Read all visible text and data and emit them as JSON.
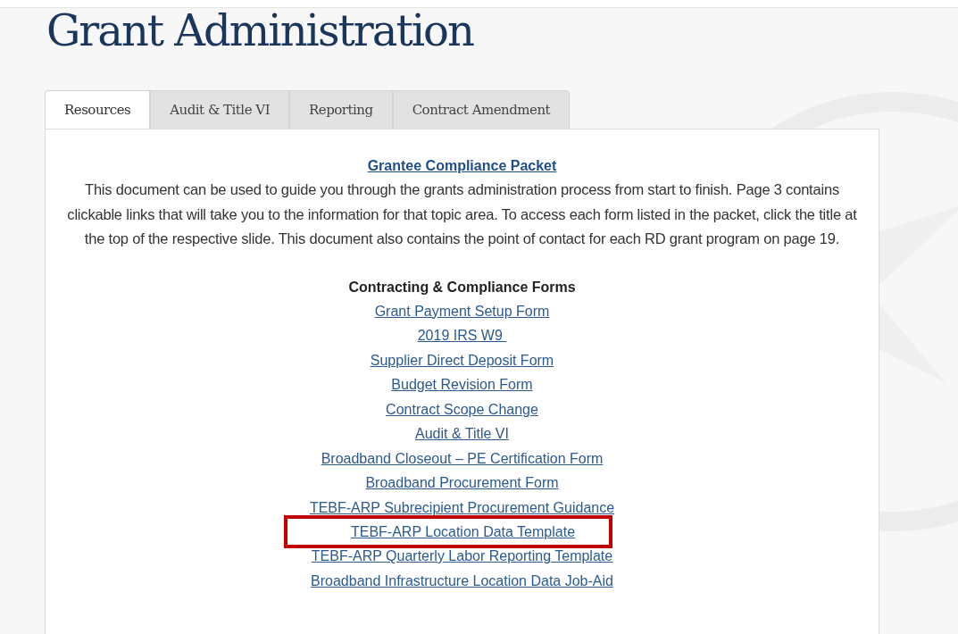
{
  "page_title": "Grant Administration",
  "tabs": [
    {
      "label": "Resources",
      "selected": true
    },
    {
      "label": "Audit & Title VI",
      "selected": false
    },
    {
      "label": "Reporting",
      "selected": false
    },
    {
      "label": "Contract Amendment",
      "selected": false
    }
  ],
  "packet": {
    "link": "Grantee Compliance Packet",
    "description": "This document can be used to guide you through the grants administration process from start to finish. Page 3 contains clickable links that will take you to the information for that topic area. To access each form listed in the packet, click the title at the top of the respective slide. This document also contains the point of contact for each RD grant program on page 19."
  },
  "forms": {
    "heading": "Contracting & Compliance Forms",
    "links": [
      {
        "label": "Grant Payment Setup Form",
        "highlighted": false
      },
      {
        "label": "2019 IRS W9 ",
        "highlighted": false
      },
      {
        "label": "Supplier Direct Deposit Form",
        "highlighted": false
      },
      {
        "label": "Budget Revision Form",
        "highlighted": false
      },
      {
        "label": "Contract Scope Change",
        "highlighted": false
      },
      {
        "label": "Audit & Title VI",
        "highlighted": false
      },
      {
        "label": "Broadband Closeout – PE Certification Form",
        "highlighted": false
      },
      {
        "label": "Broadband Procurement Form",
        "highlighted": false
      },
      {
        "label": "TEBF-ARP Subrecipient Procurement Guidance",
        "highlighted": false
      },
      {
        "label": "TEBF-ARP Location Data Template",
        "highlighted": true
      },
      {
        "label": "TEBF-ARP Quarterly Labor Reporting Template",
        "highlighted": false
      },
      {
        "label": "Broadband Infrastructure Location Data Job-Aid",
        "highlighted": false
      }
    ]
  }
}
